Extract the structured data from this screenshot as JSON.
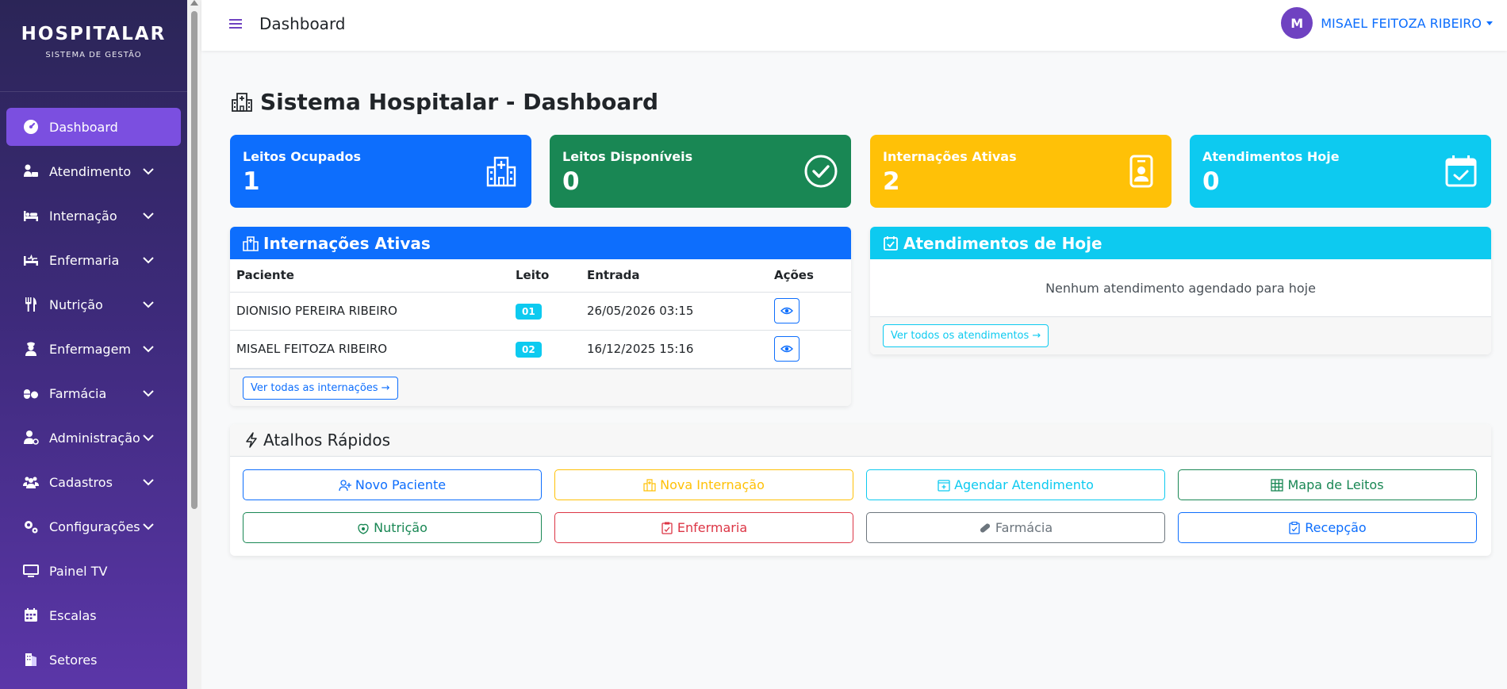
{
  "brand": {
    "title": "HOSPITALAR",
    "subtitle": "SISTEMA DE GESTÃO"
  },
  "sidebar": {
    "items": [
      {
        "label": "Dashboard",
        "icon": "gauge-icon",
        "active": true,
        "expandable": false
      },
      {
        "label": "Atendimento",
        "icon": "user-desk-icon",
        "expandable": true
      },
      {
        "label": "Internação",
        "icon": "bed-icon",
        "expandable": true
      },
      {
        "label": "Enfermaria",
        "icon": "bed-pulse-icon",
        "expandable": true
      },
      {
        "label": "Nutrição",
        "icon": "utensils-icon",
        "expandable": true
      },
      {
        "label": "Enfermagem",
        "icon": "nurse-icon",
        "expandable": true
      },
      {
        "label": "Farmácia",
        "icon": "pills-icon",
        "expandable": true
      },
      {
        "label": "Administração",
        "icon": "user-gear-icon",
        "expandable": true
      },
      {
        "label": "Cadastros",
        "icon": "users-icon",
        "expandable": true
      },
      {
        "label": "Configurações",
        "icon": "gears-icon",
        "expandable": true
      },
      {
        "label": "Painel TV",
        "icon": "tv-icon",
        "expandable": false
      },
      {
        "label": "Escalas",
        "icon": "calendar-icon",
        "expandable": false
      },
      {
        "label": "Setores",
        "icon": "building-icon",
        "expandable": false
      }
    ]
  },
  "topbar": {
    "title": "Dashboard",
    "avatar_initial": "M",
    "user_name": "MISAEL FEITOZA RIBEIRO"
  },
  "page": {
    "title": "Sistema Hospitalar - Dashboard"
  },
  "stats": [
    {
      "label": "Leitos Ocupados",
      "value": "1",
      "color": "#0d6efd",
      "icon": "hospital-icon"
    },
    {
      "label": "Leitos Disponíveis",
      "value": "0",
      "color": "#198754",
      "icon": "check-circle-icon"
    },
    {
      "label": "Internações Ativas",
      "value": "2",
      "color": "#ffc107",
      "icon": "id-badge-icon"
    },
    {
      "label": "Atendimentos Hoje",
      "value": "0",
      "color": "#0dcaf0",
      "icon": "calendar-check-icon"
    }
  ],
  "internacoes": {
    "title": "Internações Ativas",
    "columns": [
      "Paciente",
      "Leito",
      "Entrada",
      "Ações"
    ],
    "rows": [
      {
        "paciente": "DIONISIO PEREIRA RIBEIRO",
        "leito": "01",
        "entrada": "26/05/2026 03:15"
      },
      {
        "paciente": "MISAEL FEITOZA RIBEIRO",
        "leito": "02",
        "entrada": "16/12/2025 15:16"
      }
    ],
    "footer_link": "Ver todas as internações →"
  },
  "atendimentos": {
    "title": "Atendimentos de Hoje",
    "empty": "Nenhum atendimento agendado para hoje",
    "footer_link": "Ver todos os atendimentos →"
  },
  "atalhos": {
    "title": "Atalhos Rápidos",
    "buttons": [
      {
        "label": "Novo Paciente",
        "color": "#0d6efd",
        "icon": "user-plus-icon"
      },
      {
        "label": "Nova Internação",
        "color": "#ffc107",
        "icon": "hospital-icon"
      },
      {
        "label": "Agendar Atendimento",
        "color": "#0dcaf0",
        "icon": "calendar-plus-icon"
      },
      {
        "label": "Mapa de Leitos",
        "color": "#198754",
        "icon": "grid-icon"
      },
      {
        "label": "Nutrição",
        "color": "#198754",
        "icon": "apple-icon"
      },
      {
        "label": "Enfermaria",
        "color": "#dc3545",
        "icon": "clipboard-pulse-icon"
      },
      {
        "label": "Farmácia",
        "color": "#6c757d",
        "icon": "capsule-icon"
      },
      {
        "label": "Recepção",
        "color": "#0d6efd",
        "icon": "clipboard-check-icon"
      }
    ]
  }
}
